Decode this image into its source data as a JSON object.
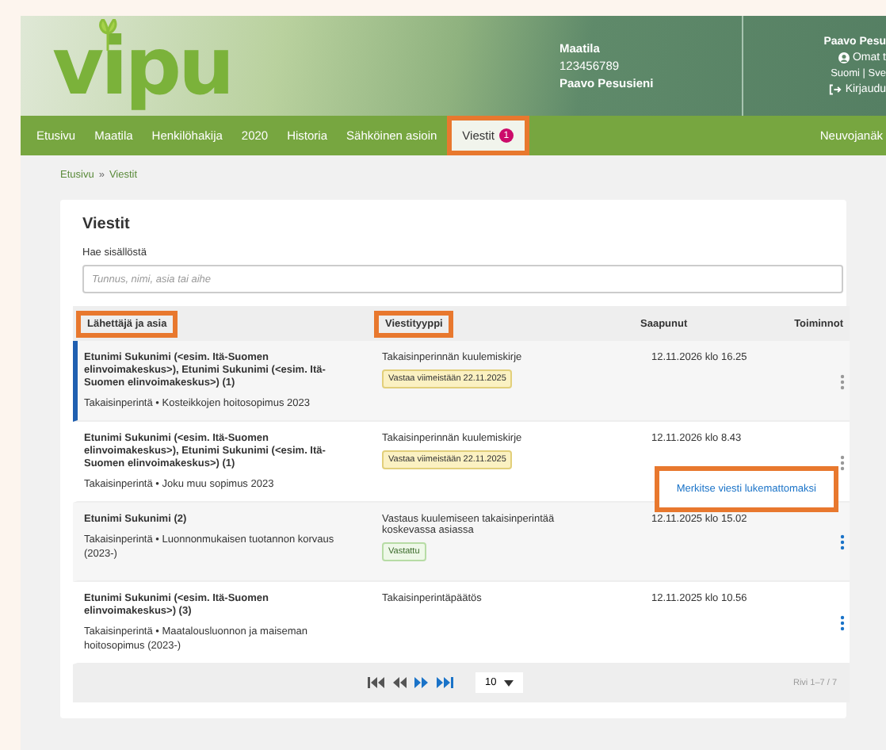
{
  "header": {
    "logo": "vipu",
    "farm": {
      "label": "Maatila",
      "id": "123456789",
      "owner": "Paavo Pesusieni"
    },
    "user": {
      "name": "Paavo Pesu",
      "profile_link": "Omat t",
      "languages": "Suomi | Sve",
      "logout": "Kirjaudu"
    }
  },
  "nav": {
    "items": [
      {
        "label": "Etusivu",
        "selected": false,
        "annotated": false
      },
      {
        "label": "Maatila",
        "selected": false,
        "annotated": false
      },
      {
        "label": "Henkilöhakija",
        "selected": false,
        "annotated": false
      },
      {
        "label": "2020",
        "selected": false,
        "annotated": false
      },
      {
        "label": "Historia",
        "selected": false,
        "annotated": false
      },
      {
        "label": "Sähköinen asioin",
        "selected": false,
        "annotated": false
      },
      {
        "label": "Viestit",
        "badge": "1",
        "selected": true,
        "annotated": true
      }
    ],
    "right_item": "Neuvojanäk"
  },
  "breadcrumb": {
    "items": [
      "Etusivu",
      "Viestit"
    ],
    "separator": "»"
  },
  "card": {
    "title": "Viestit",
    "search": {
      "label": "Hae sisällöstä",
      "placeholder": "Tunnus, nimi, asia tai aihe"
    }
  },
  "table": {
    "columns": [
      {
        "label": "Lähettäjä ja asia",
        "annotated": true
      },
      {
        "label": "Viestityyppi",
        "annotated": true
      },
      {
        "label": "Saapunut",
        "annotated": false
      },
      {
        "label": "Toiminnot",
        "annotated": false
      }
    ],
    "rows": [
      {
        "sender": "Etunimi Sukunimi (<esim. Itä-Suomen elinvoimakeskus>), Etunimi Sukunimi (<esim. Itä-Suomen elinvoimakeskus>) (1)",
        "subject": "Takaisinperintä • Kosteikkojen hoitosopimus 2023",
        "type": "Takaisinperinnän kuulemiskirje",
        "badge": {
          "kind": "deadline",
          "text": "Vastaa viimeistään 22.11.2025"
        },
        "arrived": "12.11.2026 klo 16.25",
        "unread": true
      },
      {
        "sender": "Etunimi Sukunimi (<esim. Itä-Suomen elinvoimakeskus>), Etunimi Sukunimi (<esim. Itä-Suomen elinvoimakeskus>) (1)",
        "subject": "Takaisinperintä • Joku muu sopimus 2023",
        "type": "Takaisinperinnän kuulemiskirje",
        "badge": {
          "kind": "deadline",
          "text": "Vastaa viimeistään 22.11.2025"
        },
        "arrived": "12.11.2026 klo 8.43",
        "unread": false,
        "menu": {
          "items": [
            "Merkitse viesti lukemattomaksi"
          ],
          "annotated": true
        }
      },
      {
        "sender": "Etunimi Sukunimi (2)",
        "subject": "Takaisinperintä • Luonnonmukaisen tuotannon korvaus (2023-)",
        "type": "Vastaus kuulemiseen takaisinperintää koskevassa asiassa",
        "badge": {
          "kind": "answered",
          "text": "Vastattu"
        },
        "arrived": "12.11.2025 klo 15.02",
        "unread": false
      },
      {
        "sender": "Etunimi Sukunimi (<esim. Itä-Suomen elinvoimakeskus>) (3)",
        "subject": "Takaisinperintä • Maatalousluonnon ja maiseman hoitosopimus (2023-)",
        "type": "Takaisinperintäpäätös",
        "arrived": "12.11.2025 klo 10.56",
        "unread": false
      }
    ],
    "pagination": {
      "page_size": "10",
      "range": "Rivi 1–7 / 7"
    }
  }
}
